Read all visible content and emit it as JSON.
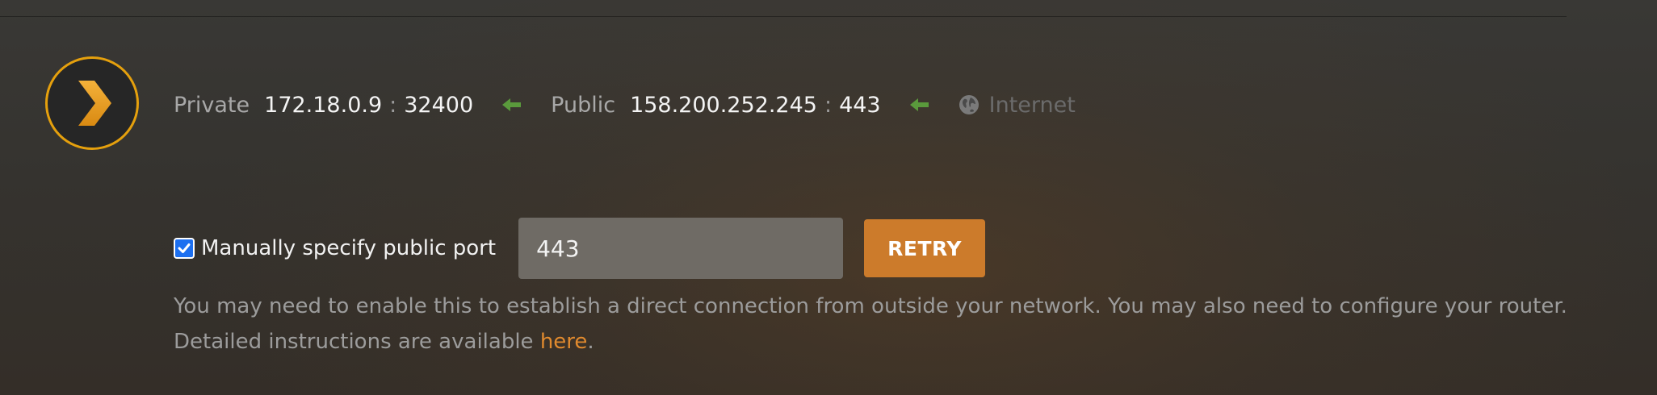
{
  "connection": {
    "private_label": "Private",
    "private_ip": "172.18.0.9",
    "private_port": "32400",
    "port_separator": ":",
    "public_label": "Public",
    "public_ip": "158.200.252.245",
    "public_port": "443",
    "internet_label": "Internet",
    "arrow_icon": "arrow-left-icon",
    "globe_icon": "globe-icon",
    "arrow_color": "#5a9a3c"
  },
  "manual_port": {
    "checkbox_checked": true,
    "checkbox_label": "Manually specify public port",
    "port_value": "443",
    "retry_label": "RETRY"
  },
  "help": {
    "text": "You may need to enable this to establish a direct connection from outside your network. You may also need to configure your router. Detailed instructions are available ",
    "link_text": "here",
    "suffix": "."
  },
  "colors": {
    "accent": "#cc7b2b",
    "logo_ring": "#e5a00d",
    "checkbox": "#1c6ff0"
  }
}
